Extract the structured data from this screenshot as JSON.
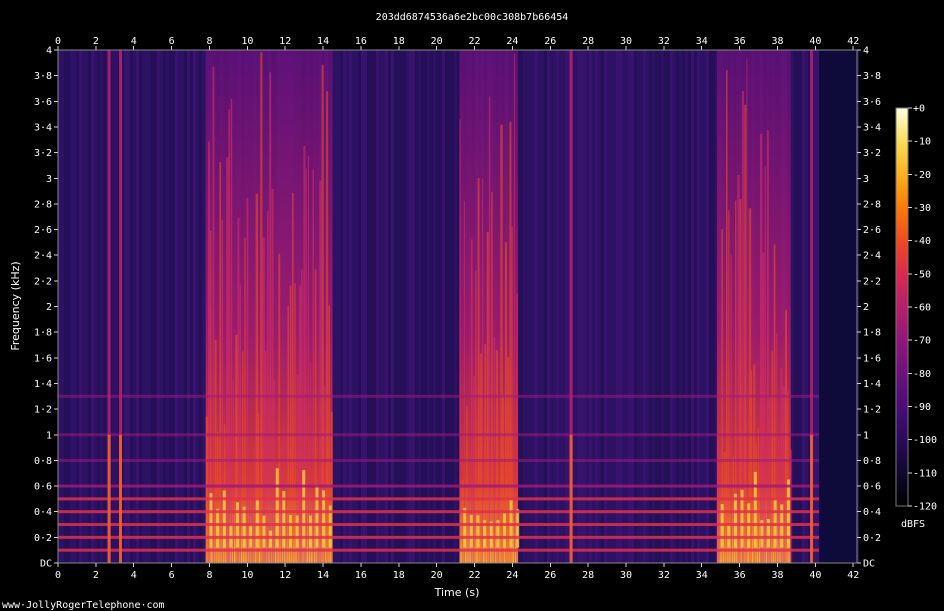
{
  "chart_data": {
    "type": "heatmap",
    "title": "203dd6874536a6e2bc00c308b7b66454",
    "xlabel": "Time (s)",
    "ylabel": "Frequency (kHz)",
    "x_ticks": [
      "0",
      "2",
      "4",
      "6",
      "8",
      "10",
      "12",
      "14",
      "16",
      "18",
      "20",
      "22",
      "24",
      "26",
      "28",
      "30",
      "32",
      "34",
      "36",
      "38",
      "40",
      "42"
    ],
    "xlim": [
      0,
      42.2
    ],
    "y_ticks": [
      "DC",
      "0·2",
      "0·4",
      "0·6",
      "0·8",
      "1",
      "1·2",
      "1·4",
      "1·6",
      "1·8",
      "2",
      "2·2",
      "2·4",
      "2·6",
      "2·8",
      "3",
      "3·2",
      "3·4",
      "3·6",
      "3·8",
      "4"
    ],
    "ylim": [
      0,
      4
    ],
    "colorbar": {
      "label": "dBFS",
      "ticks": [
        "+0",
        "-10",
        "-20",
        "-30",
        "-40",
        "-50",
        "-60",
        "-70",
        "-80",
        "-90",
        "-100",
        "-110",
        "-120"
      ],
      "range": [
        -120,
        0
      ],
      "colors": [
        "#000000",
        "#10082e",
        "#2a0a5c",
        "#4a0c78",
        "#6d117e",
        "#92167a",
        "#b81e6c",
        "#dc2a4c",
        "#f04a1e",
        "#fb7a06",
        "#fdb020",
        "#f8de5a",
        "#ffffe0"
      ]
    },
    "loud_segments_s": [
      [
        7.8,
        14.5
      ],
      [
        21.2,
        24.3
      ],
      [
        34.8,
        38.7
      ]
    ],
    "impulses_s": [
      2.7,
      3.3,
      27.1,
      39.8
    ],
    "silence_after_s": 40.2,
    "harmonics_khz": [
      0.1,
      0.2,
      0.3,
      0.4,
      0.5,
      0.6,
      0.8,
      1.0,
      1.3
    ]
  },
  "footer": {
    "watermark": "www·JollyRogerTelephone·com"
  }
}
